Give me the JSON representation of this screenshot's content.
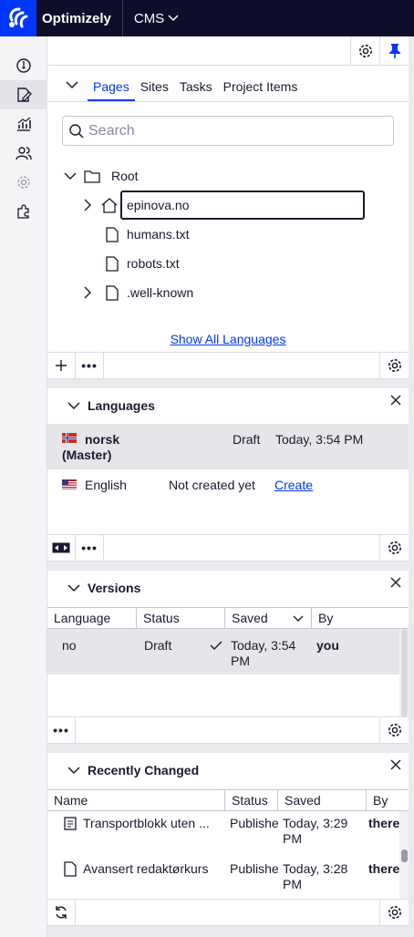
{
  "brand": {
    "name": "Optimizely",
    "product": "CMS"
  },
  "tabs": [
    {
      "label": "Pages",
      "active": true
    },
    {
      "label": "Sites",
      "active": false
    },
    {
      "label": "Tasks",
      "active": false
    },
    {
      "label": "Project Items",
      "active": false
    }
  ],
  "search": {
    "placeholder": "Search"
  },
  "tree": {
    "root": "Root",
    "items": [
      {
        "label": "epinova.no",
        "type": "home",
        "expandable": true,
        "selected": true
      },
      {
        "label": "humans.txt",
        "type": "file"
      },
      {
        "label": "robots.txt",
        "type": "file"
      },
      {
        "label": ".well-known",
        "type": "file",
        "expandable": true
      }
    ],
    "show_all_languages": "Show All Languages"
  },
  "languages": {
    "title": "Languages",
    "rows": [
      {
        "name": "norsk",
        "suffix": "(Master)",
        "status": "Draft",
        "saved": "Today, 3:54 PM",
        "flag": "no"
      },
      {
        "name": "English",
        "status": "Not created yet",
        "action": "Create",
        "flag": "us"
      }
    ]
  },
  "versions": {
    "title": "Versions",
    "columns": [
      "Language",
      "Status",
      "Saved",
      "By"
    ],
    "rows": [
      {
        "language": "no",
        "status": "Draft",
        "saved": "Today, 3:54 PM",
        "by": "you"
      }
    ]
  },
  "recently_changed": {
    "title": "Recently Changed",
    "columns": [
      "Name",
      "Status",
      "Saved",
      "By"
    ],
    "rows": [
      {
        "name": "Transportblokk uten ...",
        "status": "Publishe",
        "saved": "Today, 3:29 PM",
        "by": "there"
      },
      {
        "name": "Avansert redaktørkurs",
        "status": "Publishe",
        "saved": "Today, 3:28 PM",
        "by": "there"
      }
    ]
  },
  "colors": {
    "accent": "#0037ff",
    "topbar": "#0e0e2c"
  }
}
